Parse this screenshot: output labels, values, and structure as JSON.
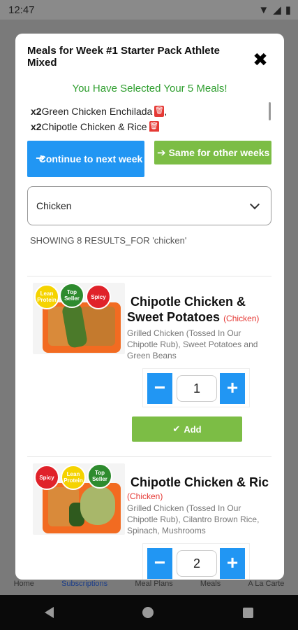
{
  "status": {
    "time": "12:47"
  },
  "modal": {
    "title": "Meals for Week #1 Starter Pack Athlete Mixed",
    "close_icon": "close-icon",
    "selected_message": "You Have Selected Your 5 Meals!",
    "selected_items": [
      {
        "qty": "x2",
        "name": "Green Chicken Enchilada",
        "suffix": ","
      },
      {
        "qty": "x2",
        "name": "Chipotle Chicken & Rice",
        "suffix": ""
      }
    ],
    "continue_label": "Continue to next week",
    "same_label": "Same for other weeks",
    "filter_value": "Chicken",
    "results_text": "SHOWING 8 RESULTS_FOR 'chicken'",
    "colors": {
      "blue": "#2196f3",
      "green": "#7cbd45",
      "title_green": "#2e9e2e",
      "category_red": "#e53935"
    }
  },
  "meals": [
    {
      "badges": [
        "Lean Protein",
        "Top Seller",
        "Spicy"
      ],
      "name_line1": "Chipotle Chicken &",
      "name_line2": "Sweet Potatoes",
      "category": "(Chicken)",
      "description": "Grilled Chicken (Tossed In Our Chipotle Rub), Sweet Potatoes and Green Beans",
      "quantity": "1",
      "add_label": "Add"
    },
    {
      "badges": [
        "Spicy",
        "Lean Protein",
        "Top Seller"
      ],
      "name_line1": "Chipotle Chicken & Ric",
      "category": "(Chicken)",
      "description": "Grilled Chicken (Tossed In Our Chipotle Rub), Cilantro Brown Rice, Spinach, Mushrooms",
      "quantity": "2"
    }
  ],
  "bottom_tabs": [
    "Home",
    "Subscriptions",
    "Meal Plans",
    "Meals",
    "A La Carte"
  ]
}
